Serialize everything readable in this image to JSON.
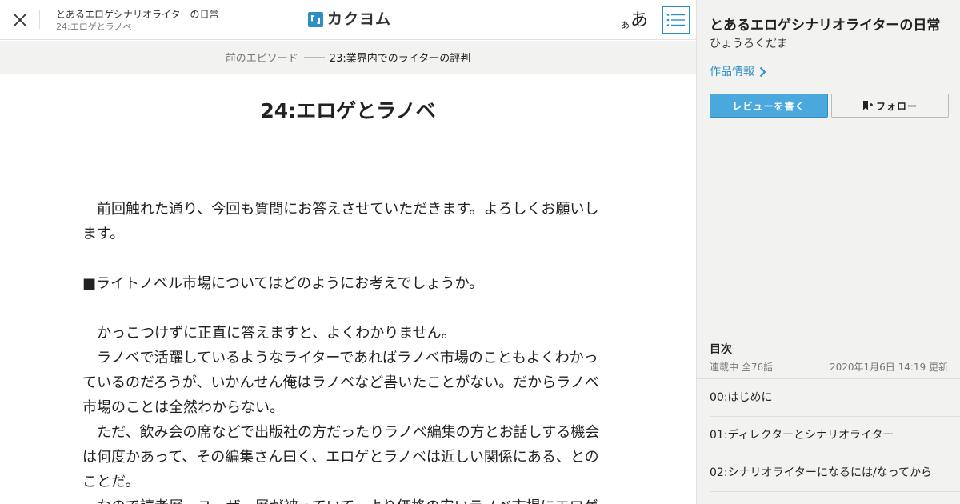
{
  "header": {
    "work_title": "とあるエロゲシナリオライターの日常",
    "episode_title": "24:エロゲとラノベ",
    "logo_text": "カクヨム",
    "font_size_small": "あ",
    "font_size_large": "あ"
  },
  "prev_episode": {
    "label": "前のエピソード",
    "title": "23:業界内でのライターの評判"
  },
  "episode": {
    "heading": "24:エロゲとラノベ",
    "paragraphs": [
      "　前回触れた通り、今回も質問にお答えさせていただきます。よろしくお願いします。",
      "",
      "■ライトノベル市場についてはどのようにお考えでしょうか。",
      "",
      "　かっこつけずに正直に答えますと、よくわかりません。",
      "　ラノベで活躍しているようなライターであればラノベ市場のこともよくわかっているのだろうが、いかんせん俺はラノベなど書いたことがない。だからラノベ市場のことは全然わからない。",
      "　ただ、飲み会の席などで出版社の方だったりラノベ編集の方とお話しする機会は何度かあって、その編集さん曰く、エロゲとラノベは近しい関係にある、とのことだ。",
      "　なので読者層、ユーザー層が被っていて、より価格の安いラノベ市場にエロゲ"
    ]
  },
  "sidebar": {
    "work_title": "とあるエロゲシナリオライターの日常",
    "author": "ひょうろくだま",
    "info_link": "作品情報",
    "review_button": "レビューを書く",
    "follow_button": "フォロー",
    "toc": {
      "heading": "目次",
      "status": "連載中 全76話",
      "updated": "2020年1月6日 14:19 更新",
      "items": [
        "00:はじめに",
        "01:ディレクターとシナリオライター",
        "02:シナリオライターになるには/なってから"
      ]
    }
  },
  "colors": {
    "accent": "#2c8ec5",
    "button_blue": "#4ba8dc",
    "sidebar_bg": "#f2f2f0"
  }
}
